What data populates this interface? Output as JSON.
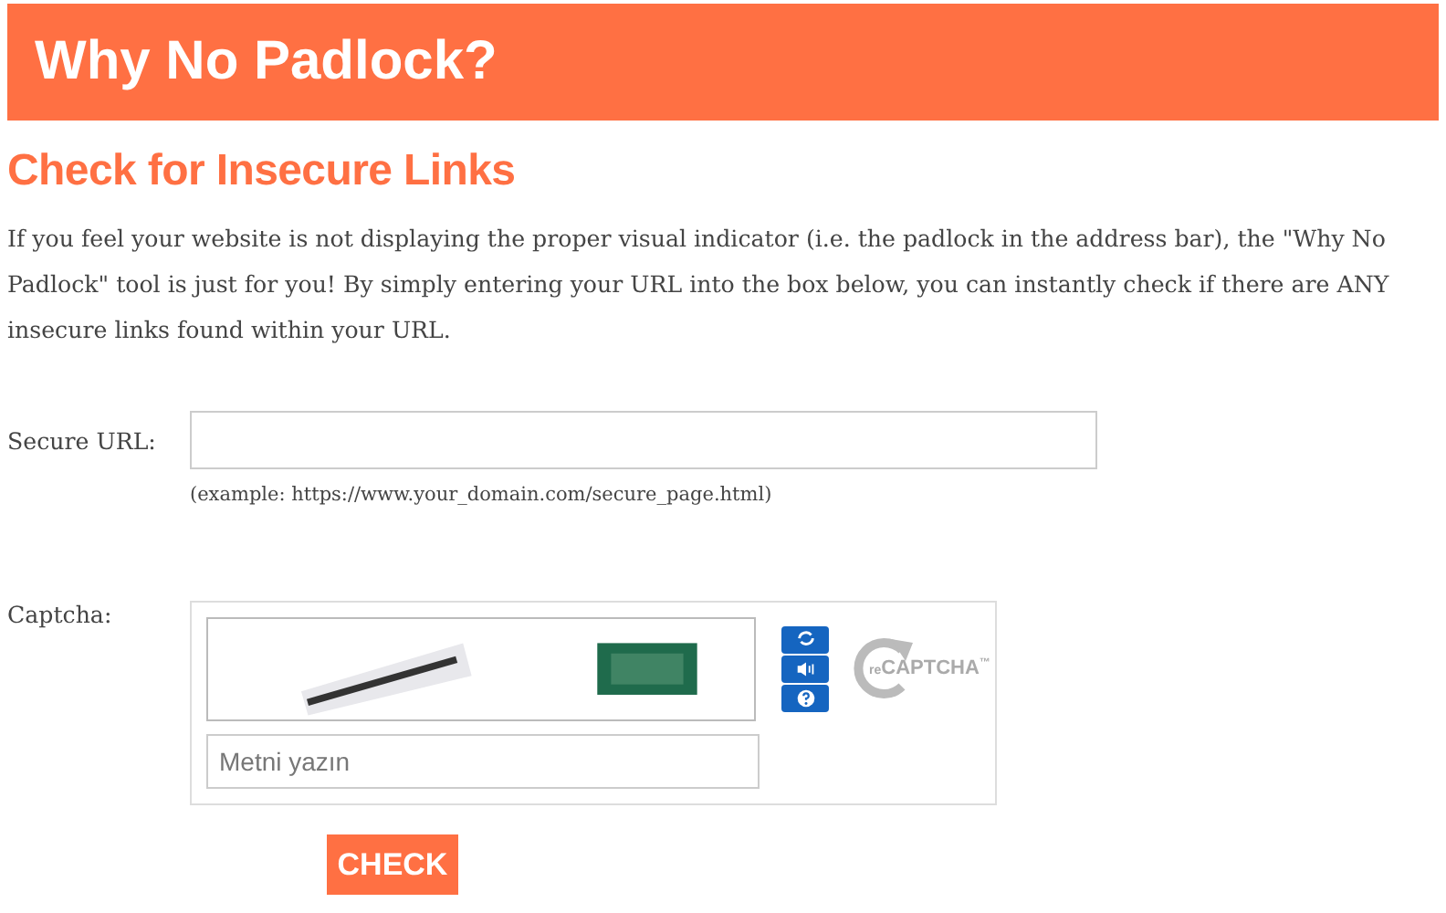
{
  "header": {
    "title": "Why No Padlock?"
  },
  "heading": "Check for Insecure Links",
  "intro": "If you feel your website is not displaying the proper visual indicator (i.e. the padlock in the address bar), the \"Why No Padlock\" tool is just for you! By simply entering your URL into the box below, you can instantly check if there are ANY insecure links found within your URL.",
  "url_field": {
    "label": "Secure URL:",
    "hint": "(example: https://www.your_domain.com/secure_page.html)"
  },
  "captcha": {
    "label": "Captcha:",
    "placeholder": "Metni yazın",
    "logo_text": "**re**CAPTCHA$^{™}$"
  },
  "submit": {
    "label": "CHECK"
  }
}
